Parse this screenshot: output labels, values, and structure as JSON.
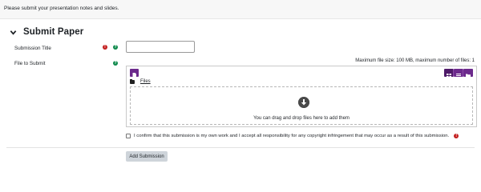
{
  "intro": {
    "text": "Please submit your presentation notes and slides."
  },
  "section": {
    "title": "Submit Paper",
    "icon": "chevron-down-icon"
  },
  "fields": {
    "submission_title_label": "Submission Title",
    "file_to_submit_label": "File to Submit"
  },
  "filepicker": {
    "max_info": "Maximum file size: 100 MB, maximum number of files: 1",
    "path_label": "Files",
    "drop_text": "You can drag and drop files here to add them",
    "icons": [
      "add-file-icon",
      "view-icons-icon",
      "view-list-icon",
      "view-tree-icon",
      "folder-icon",
      "download-arrow-icon"
    ]
  },
  "confirm": {
    "text": "I confirm that this submission is my own work and I accept all responsibility for any copyright infringement that may occur as a result of this submission."
  },
  "buttons": {
    "submit_label": "Add Submission"
  },
  "colors": {
    "accent": "#6c2a8c",
    "required": "#c31f1f",
    "help": "#0f8a4c"
  }
}
